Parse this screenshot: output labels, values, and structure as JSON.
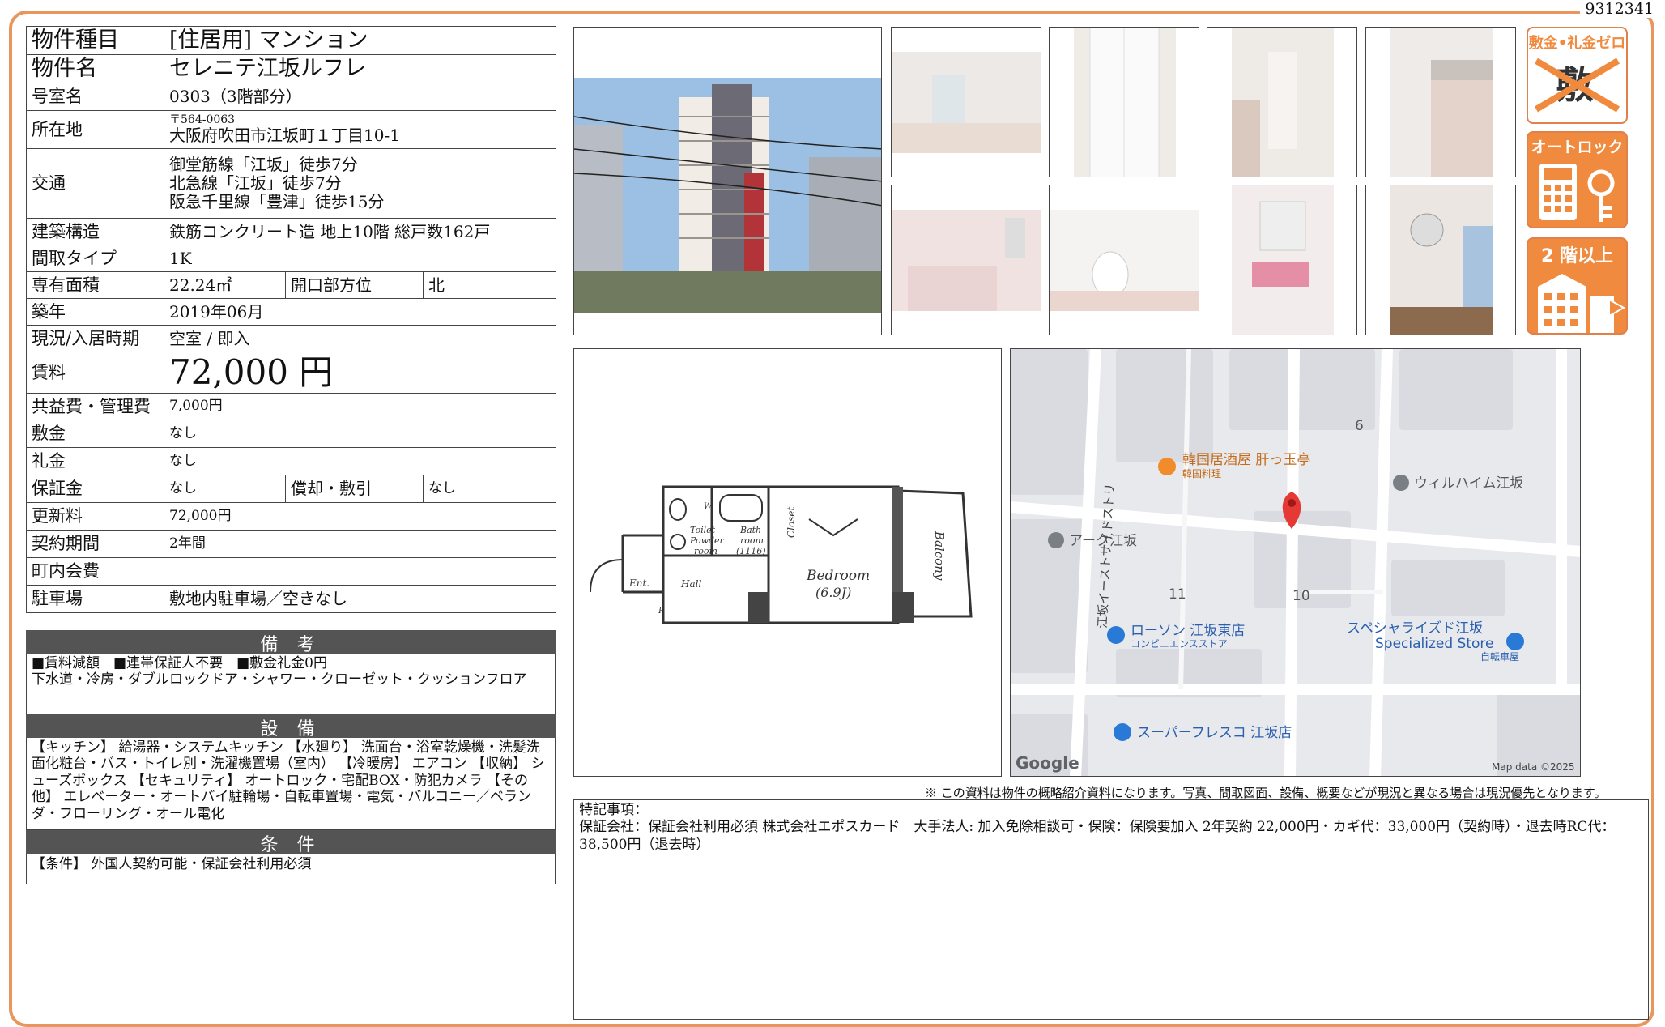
{
  "doc_id": "9312341",
  "info": {
    "type_label": "物件種目",
    "type_value": "[住居用] マンション",
    "name_label": "物件名",
    "name_value": "セレニテ江坂ルフレ",
    "room_label": "号室名",
    "room_value": "0303（3階部分）",
    "address_label": "所在地",
    "postal": "〒564-0063",
    "address_value": "大阪府吹田市江坂町１丁目10-1",
    "transport_label": "交通",
    "transport": [
      "御堂筋線「江坂」徒歩7分",
      "北急線「江坂」徒歩7分",
      "阪急千里線「豊津」徒歩15分"
    ],
    "structure_label": "建築構造",
    "structure_value": "鉄筋コンクリート造 地上10階 総戸数162戸",
    "layout_label": "間取タイプ",
    "layout_value": "1K",
    "area_label": "専有面積",
    "area_value": "22.24㎡",
    "direction_label": "開口部方位",
    "direction_value": "北",
    "built_label": "築年",
    "built_value": "2019年06月",
    "status_label": "現況/入居時期",
    "status_value": "空室 / 即入",
    "rent_label": "賃料",
    "rent_value": "72,000 円",
    "fee_label": "共益費・管理費",
    "fee_value": "7,000円",
    "deposit_label": "敷金",
    "deposit_value": "なし",
    "key_money_label": "礼金",
    "key_money_value": "なし",
    "guarantee_label": "保証金",
    "guarantee_value": "なし",
    "amort_label": "償却・敷引",
    "amort_value": "なし",
    "renewal_label": "更新料",
    "renewal_value": "72,000円",
    "contract_label": "契約期間",
    "contract_value": "2年間",
    "town_fee_label": "町内会費",
    "town_fee_value": "",
    "parking_label": "駐車場",
    "parking_value": "敷地内駐車場／空きなし"
  },
  "remarks": {
    "heading": "備 考",
    "line1": "■賃料減額　■連帯保証人不要　■敷金礼金0円",
    "line2": "下水道・冷房・ダブルロックドア・シャワー・クローゼット・クッションフロア"
  },
  "equipment": {
    "heading": "設 備",
    "text": "【キッチン】 給湯器・システムキッチン 【水廻り】 洗面台・浴室乾燥機・洗髪洗面化粧台・バス・トイレ別・洗濯機置場（室内） 【冷暖房】 エアコン 【収納】 シューズボックス 【セキュリティ】 オートロック・宅配BOX・防犯カメラ 【その他】 エレベーター・オートバイ駐輪場・自転車置場・電気・バルコニー／ベランダ・フローリング・オール電化"
  },
  "conditions": {
    "heading": "条 件",
    "text": "【条件】 外国人契約可能・保証会社利用必須"
  },
  "badges": {
    "zero_title": "敷金•礼金ゼロ",
    "zero_marks": "敷 礼",
    "autolock_title": "オートロック",
    "floor_title": "2 階以上"
  },
  "floorplan": {
    "toilet": "Toilet",
    "powder": "Powder",
    "room": "room",
    "bath": "Bath",
    "bath_room": "room",
    "bath_size": "(1116)",
    "closet": "Closet",
    "bedroom": "Bedroom",
    "bedroom_size": "(6.9J)",
    "balcony": "Balcony",
    "hall": "Hall",
    "ent": "Ent.",
    "w": "W",
    "r": "R"
  },
  "map": {
    "street": "江坂イーストサイドストリ",
    "num6": "6",
    "num11": "11",
    "num10": "10",
    "poi_korean": "韓国居酒屋 肝っ玉亭",
    "poi_korean_sub": "韓国料理",
    "poi_wilheim": "ウィルハイム江坂",
    "poi_ark": "アーク江坂",
    "poi_lawson": "ローソン 江坂東店",
    "poi_lawson_sub": "コンビニエンスストア",
    "poi_specialized": "スペシャライズド江坂",
    "poi_specialized_en": "Specialized Store",
    "poi_specialized_sub": "自転車屋",
    "poi_fresco": "スーパーフレスコ 江坂店",
    "google": "Google",
    "copyright": "Map data ©2025"
  },
  "disclaimer": "※ この資料は物件の概略紹介資料になります。写真、間取図面、設備、概要などが現況と異なる場合は現況優先となります。",
  "memo": {
    "title": "特記事項：",
    "text": "保証会社：保証会社利用必須 株式会社エポスカード　大手法人: 加入免除相談可・保険：保険要加入 2年契約 22,000円・カギ代：33,000円（契約時）・退去時RC代：38,500円（退去時）"
  },
  "colors": {
    "frame": "#e8955e",
    "badge": "#f08a3e",
    "header": "#545454",
    "pin": "#e53935"
  }
}
